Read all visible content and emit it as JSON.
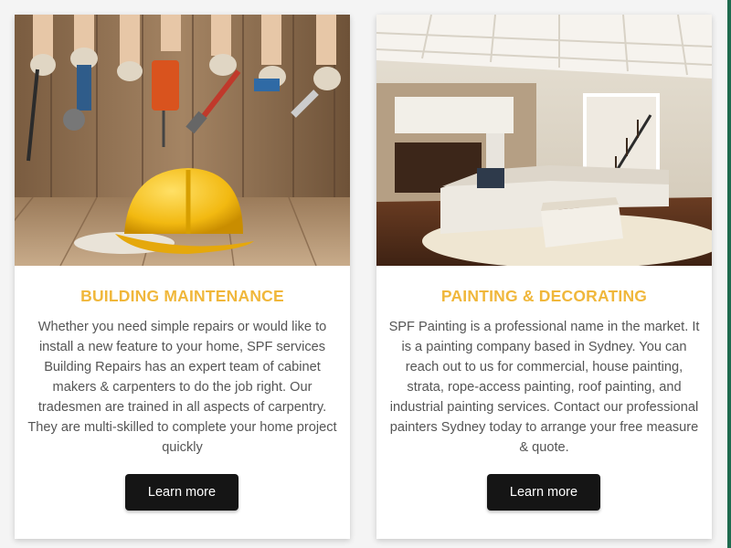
{
  "theme": {
    "accent": "#f0b73b",
    "text": "#555555",
    "button_bg": "#151515",
    "button_text": "#ffffff"
  },
  "cards": [
    {
      "image_alt": "construction-tools-helmet-photo",
      "title": "BUILDING MAINTENANCE",
      "body": "Whether you need simple repairs or would like to install a new feature to your home, SPF services Building Repairs has an expert team of cabinet makers & carpenters to do the job right. Our tradesmen are trained in all aspects of carpentry. They are multi-skilled to complete your home project quickly",
      "button_label": "Learn more"
    },
    {
      "image_alt": "living-room-interior-photo",
      "title": "PAINTING & DECORATING",
      "body": "SPF Painting is a professional name in the market. It is a painting company based in Sydney. You can reach out to us for commercial, house painting, strata, rope-access painting, roof painting, and industrial painting services. Contact our professional painters Sydney today to arrange your free measure & quote.",
      "button_label": "Learn more"
    }
  ]
}
